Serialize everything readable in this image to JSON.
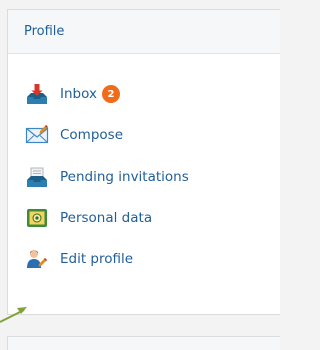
{
  "card": {
    "title": "Profile"
  },
  "menu": [
    {
      "label": "Inbox",
      "icon": "inbox-icon",
      "badge": "2"
    },
    {
      "label": "Compose",
      "icon": "envelope-icon"
    },
    {
      "label": "Pending invitations",
      "icon": "pending-tray-icon"
    },
    {
      "label": "Personal data",
      "icon": "id-card-icon"
    },
    {
      "label": "Edit profile",
      "icon": "user-edit-icon"
    }
  ],
  "colors": {
    "link": "#1f5f99",
    "badge": "#f06b1a",
    "pointer": "#7fa33a"
  }
}
